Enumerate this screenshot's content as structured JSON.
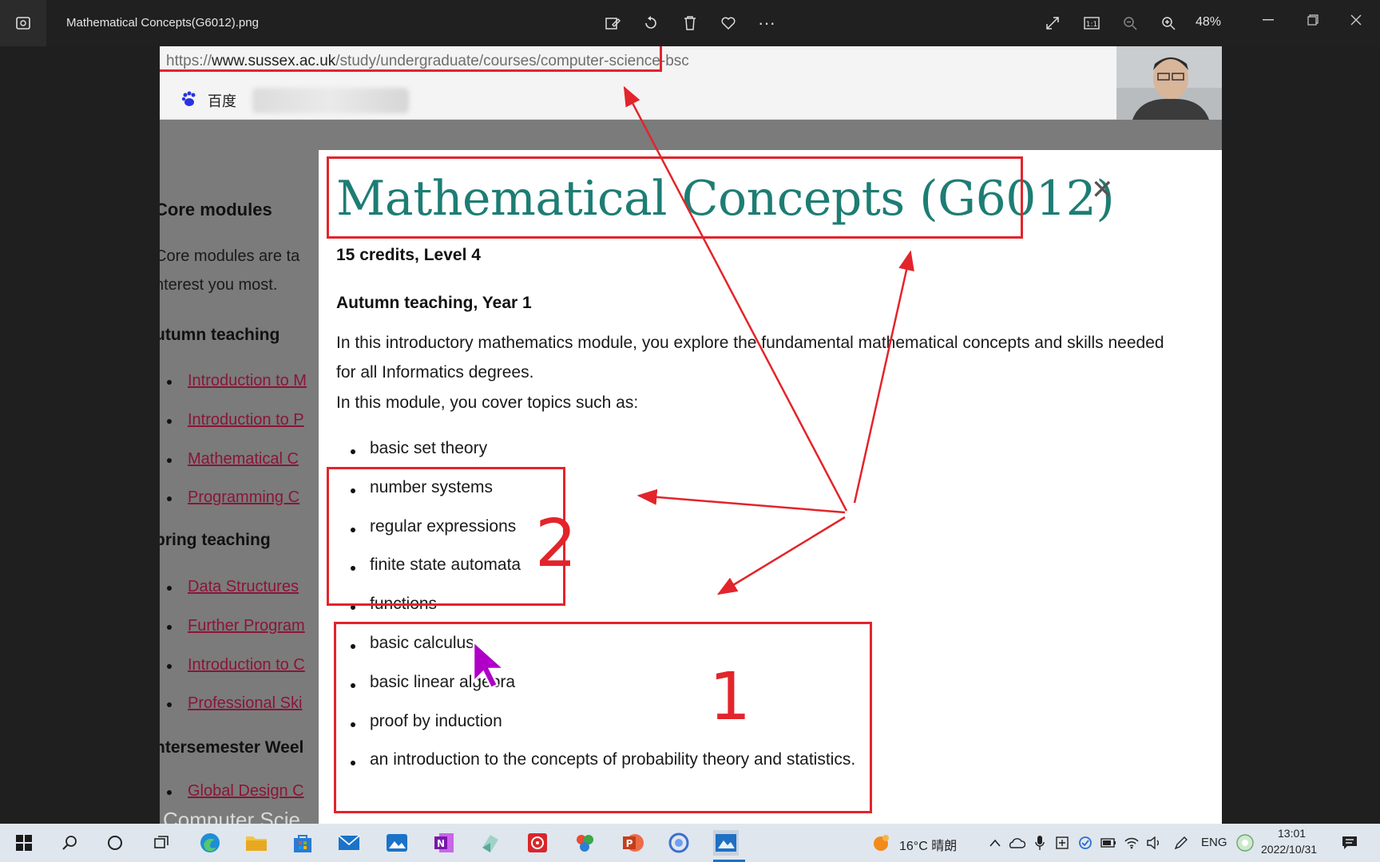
{
  "window": {
    "title": "Mathematical Concepts(G6012).png",
    "zoom": "48%"
  },
  "browser": {
    "url_scheme": "https://",
    "url_host_prefix": "www.",
    "url_domain": "sussex.ac.uk",
    "url_path": "/study/undergraduate/courses/computer-science-bsc",
    "bookmark_label": "百度"
  },
  "background_page": {
    "core_heading": "Core modules",
    "core_text_1": "Core modules are ta",
    "core_text_2": "nterest you most.",
    "autumn_heading": "utumn teaching",
    "autumn_items": [
      "Introduction to M",
      "Introduction to P",
      "Mathematical C",
      "Programming C"
    ],
    "spring_heading": "pring teaching",
    "spring_items": [
      "Data Structures",
      "Further Program",
      "Introduction to C",
      "Professional Ski"
    ],
    "inter_heading": "ntersemester Weel",
    "inter_items": [
      "Global Design C"
    ],
    "bottom_text": "Computer Scie"
  },
  "modal": {
    "title": "Mathematical Concepts (G6012)",
    "close": "✕",
    "credits": "15 credits, Level 4",
    "teaching": "Autumn teaching, Year 1",
    "intro": "In this introductory mathematics module, you explore the fundamental mathematical concepts and skills needed for all Informatics degrees.",
    "topics_intro": "In this module, you cover topics such as:",
    "topics_group_2": [
      "basic set theory",
      "number systems",
      "regular expressions",
      "finite state automata"
    ],
    "topics_group_1": [
      "functions",
      "basic calculus",
      "basic linear algebra",
      "proof by induction",
      "an introduction to the concepts of probability theory and statistics."
    ]
  },
  "annotations": {
    "label_2": "2",
    "label_1": "1",
    "color": "#e3242b"
  },
  "taskbar": {
    "weather": "16°C 晴朗",
    "lang": "ENG",
    "time": "13:01",
    "date": "2022/10/31"
  }
}
